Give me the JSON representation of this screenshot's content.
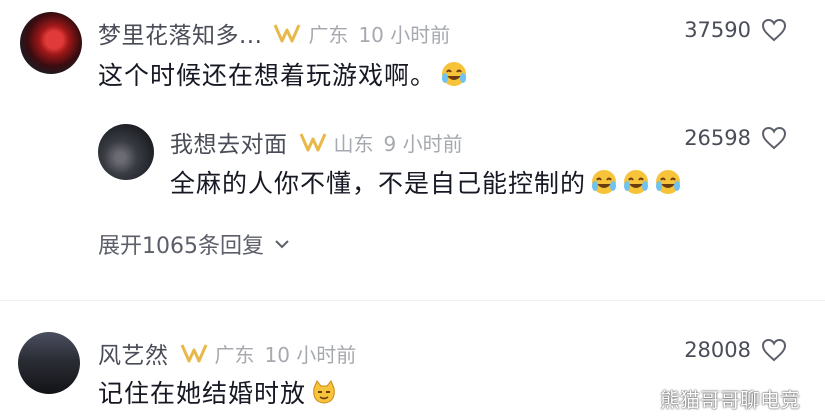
{
  "comments": [
    {
      "name": "梦里花落知多...",
      "location": "广东",
      "time": "10 小时前",
      "text": "这个时候还在想着玩游戏啊。",
      "likes": "37590",
      "emoji": [
        "laugh-cry-emoji"
      ]
    },
    {
      "name": "我想去对面",
      "location": "山东",
      "time": "9 小时前",
      "text": "全麻的人你不懂，不是自己能控制的",
      "likes": "26598",
      "emoji": [
        "laugh-cry-emoji",
        "laugh-cry-emoji",
        "laugh-cry-emoji"
      ]
    },
    {
      "name": "风艺然",
      "location": "广东",
      "time": "10 小时前",
      "text": "记住在她结婚时放",
      "likes": "28008",
      "emoji": [
        "cat-face-emoji"
      ]
    }
  ],
  "expand_replies": "展开1065条回复",
  "watermark": "熊猫哥哥聊电竞",
  "colors": {
    "name": "#4a4d57",
    "meta": "#a7a9b0",
    "badge": "#e8b84a",
    "emoji": "#f6c33b"
  },
  "icons": [
    "heart-outline-icon",
    "chevron-down-icon",
    "vip-badge-icon",
    "weibo-logo-icon"
  ]
}
